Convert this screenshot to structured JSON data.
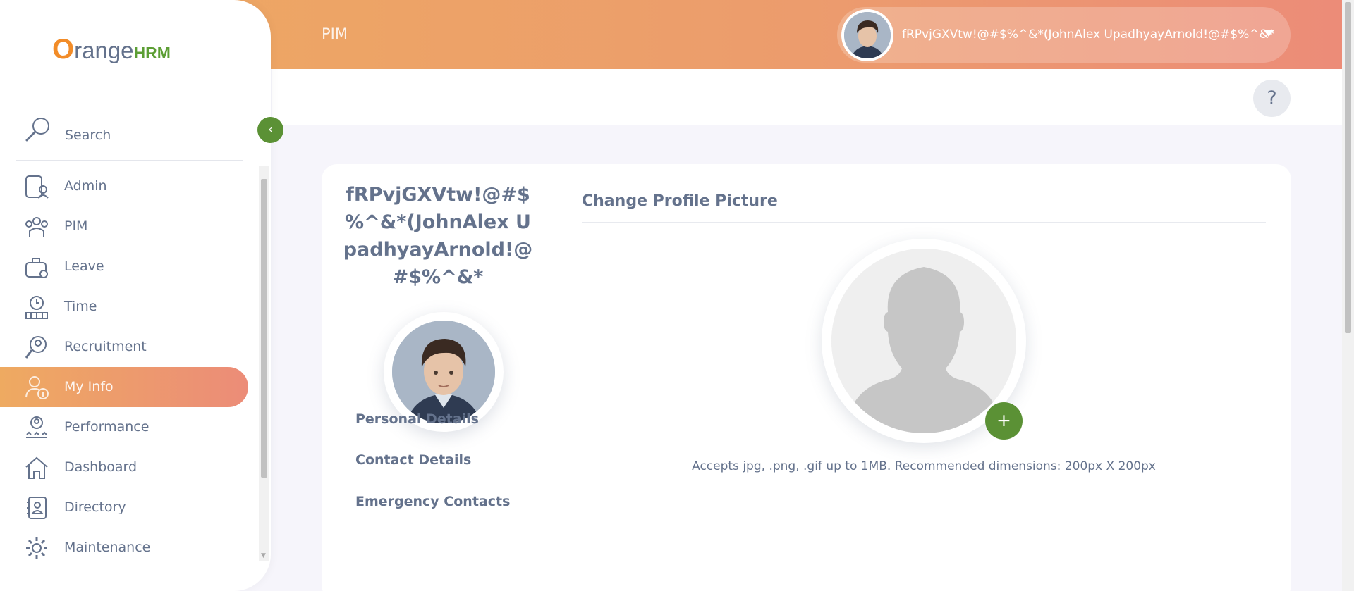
{
  "header": {
    "module_title": "PIM",
    "user_name": "fRPvjGXVtw!@#$%^&*(JohnAlex UpadhyayArnold!@#$%^&*",
    "help_label": "?"
  },
  "sidebar": {
    "brand": {
      "o": "O",
      "range": "range",
      "hrm": "HRM"
    },
    "search_label": "Search",
    "collapse_label": "‹",
    "items": [
      {
        "label": "Admin",
        "icon": "admin-icon"
      },
      {
        "label": "PIM",
        "icon": "pim-icon"
      },
      {
        "label": "Leave",
        "icon": "leave-icon"
      },
      {
        "label": "Time",
        "icon": "time-icon"
      },
      {
        "label": "Recruitment",
        "icon": "recruitment-icon"
      },
      {
        "label": "My Info",
        "icon": "my-info-icon",
        "active": true
      },
      {
        "label": "Performance",
        "icon": "performance-icon"
      },
      {
        "label": "Dashboard",
        "icon": "dashboard-icon"
      },
      {
        "label": "Directory",
        "icon": "directory-icon"
      },
      {
        "label": "Maintenance",
        "icon": "maintenance-icon"
      }
    ]
  },
  "profile": {
    "employee_name": "fRPvjGXVtw!@#$%^&*(JohnAlex UpadhyayArnold!@#$%^&*",
    "tabs": [
      "Personal Details",
      "Contact Details",
      "Emergency Contacts"
    ]
  },
  "change_picture": {
    "title": "Change Profile Picture",
    "add_label": "+",
    "hint": "Accepts jpg, .png, .gif up to 1MB. Recommended dimensions: 200px X 200px"
  },
  "colors": {
    "accent_start": "#eeaa61",
    "accent_end": "#ec8c78",
    "green": "#5b9135",
    "text": "#64728c"
  }
}
